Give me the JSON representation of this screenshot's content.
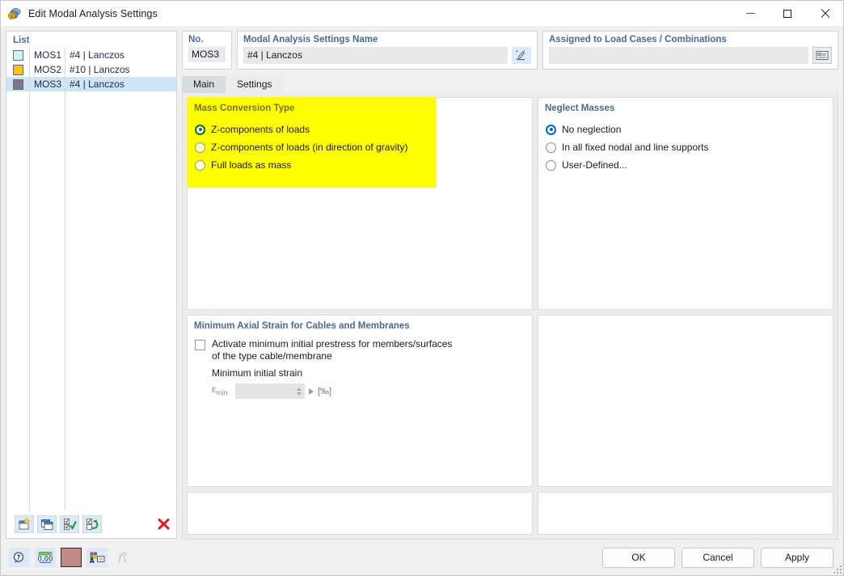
{
  "window": {
    "title": "Edit Modal Analysis Settings",
    "icon": "modal-analysis-icon",
    "minimize_label": "Minimize",
    "maximize_label": "Maximize",
    "close_label": "Close"
  },
  "list": {
    "header": "List",
    "rows": [
      {
        "no": "MOS1",
        "description": "#4 | Lanczos",
        "color": "#CBF3F5",
        "selected": false
      },
      {
        "no": "MOS2",
        "description": "#10 | Lanczos",
        "color": "#FDC500",
        "selected": false
      },
      {
        "no": "MOS3",
        "description": "#4 | Lanczos",
        "color": "#7D7691",
        "selected": true
      }
    ],
    "toolbar": [
      {
        "name": "new-item-button",
        "label": "New"
      },
      {
        "name": "copy-item-button",
        "label": "Copy"
      },
      {
        "name": "select-all-button",
        "label": "Select All"
      },
      {
        "name": "invert-selection-button",
        "label": "Invert Selection"
      },
      {
        "name": "delete-item-button",
        "label": "Delete"
      }
    ]
  },
  "header": {
    "no_label": "No.",
    "no_value": "MOS3",
    "name_label": "Modal Analysis Settings Name",
    "name_value": "#4 | Lanczos",
    "name_edit_button": "Edit name",
    "assigned_label": "Assigned to Load Cases / Combinations",
    "assigned_value": "",
    "assigned_button": "Select load cases"
  },
  "tabs": [
    {
      "label": "Main",
      "active": false
    },
    {
      "label": "Settings",
      "active": true
    }
  ],
  "mass_conversion": {
    "title": "Mass Conversion Type",
    "highlight_color": "#ffff00",
    "options": [
      {
        "label": "Z-components of loads",
        "selected": true
      },
      {
        "label": "Z-components of loads (in direction of gravity)",
        "selected": false
      },
      {
        "label": "Full loads as mass",
        "selected": false
      }
    ]
  },
  "neglect_masses": {
    "title": "Neglect Masses",
    "options": [
      {
        "label": "No neglection",
        "selected": true
      },
      {
        "label": "In all fixed nodal and line supports",
        "selected": false
      },
      {
        "label": "User-Defined...",
        "selected": false
      }
    ]
  },
  "min_axial_strain": {
    "title": "Minimum Axial Strain for Cables and Membranes",
    "activate_label_line1": "Activate minimum initial prestress for members/surfaces",
    "activate_label_line2": "of the type cable/membrane",
    "activate_checked": false,
    "sub_label": "Minimum initial strain",
    "eps_symbol": "ε",
    "eps_subscript": "min",
    "eps_value": "",
    "unit": "[‰]"
  },
  "footer": {
    "icons": [
      {
        "name": "help-info-icon",
        "label": "Info"
      },
      {
        "name": "decimal-places-icon",
        "label": "Decimal places"
      },
      {
        "name": "color-swatch-icon",
        "label": "Color",
        "color": "#C08A86"
      },
      {
        "name": "display-properties-icon",
        "label": "Display properties"
      },
      {
        "name": "formula-icon",
        "label": "Formula",
        "disabled": true
      }
    ],
    "buttons": [
      {
        "name": "ok-button",
        "label": "OK"
      },
      {
        "name": "cancel-button",
        "label": "Cancel"
      },
      {
        "name": "apply-button",
        "label": "Apply"
      }
    ]
  }
}
